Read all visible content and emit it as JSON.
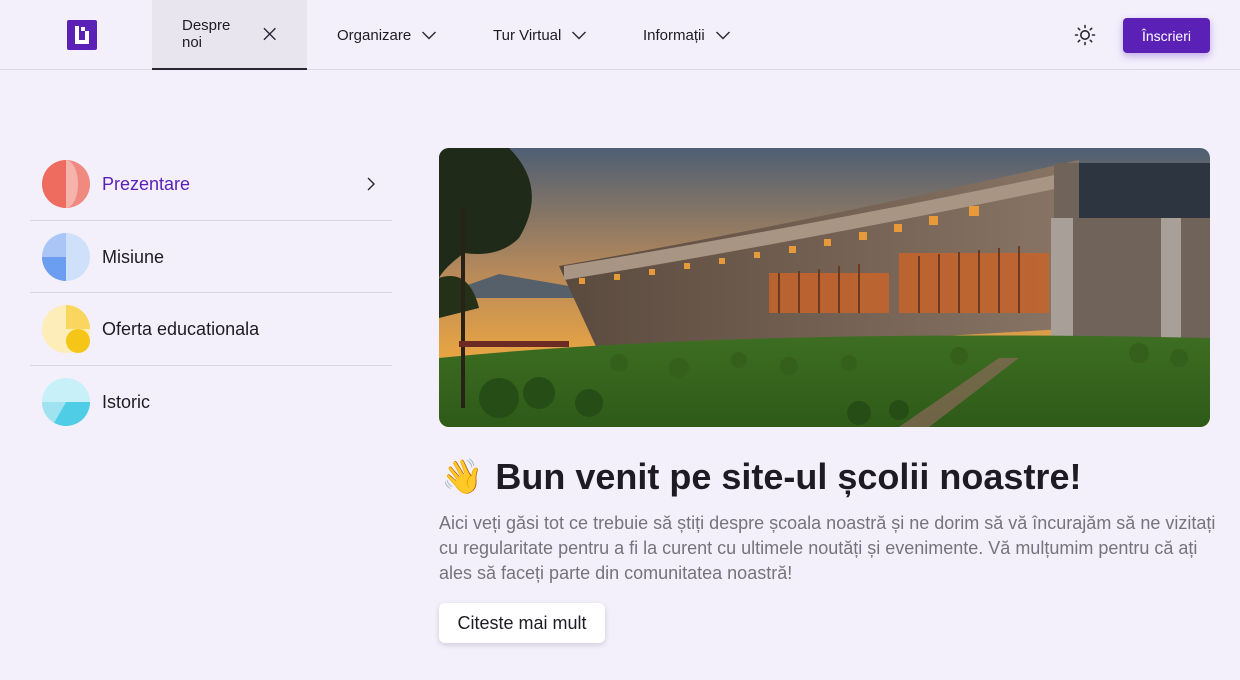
{
  "header": {
    "logo_icon": "university-logo-icon",
    "tabs": [
      {
        "label": "Despre noi",
        "icon": "close-icon",
        "active": true
      },
      {
        "label": "Organizare",
        "icon": "chevron-down-icon"
      },
      {
        "label": "Tur Virtual",
        "icon": "chevron-down-icon"
      },
      {
        "label": "Informații",
        "icon": "chevron-down-icon"
      }
    ],
    "theme_icon": "sun-icon",
    "signup_label": "Înscrieri",
    "accent": "#5b21b6"
  },
  "sidebar": {
    "items": [
      {
        "label": "Prezentare",
        "icon": "presentation-pie-icon",
        "color": "#ee6b5f",
        "active": true
      },
      {
        "label": "Misiune",
        "icon": "mission-pie-icon",
        "color": "#6b9ef0"
      },
      {
        "label": "Oferta educationala",
        "icon": "education-pie-icon",
        "color": "#f5c518"
      },
      {
        "label": "Istoric",
        "icon": "history-pie-icon",
        "color": "#4fcce6"
      }
    ]
  },
  "main": {
    "hero_image": "campus-building-sunset-photo",
    "wave_emoji": "👋",
    "title": "Bun venit pe site-ul școlii noastre!",
    "text": "Aici veți găsi tot ce trebuie să știți despre școala noastră și ne dorim să vă încurajăm să ne vizitați cu regularitate pentru a fi la curent cu ultimele noutăți și evenimente. Vă mulțumim pentru că ați ales să faceți parte din comunitatea noastră!",
    "button_label": "Citeste mai mult"
  }
}
